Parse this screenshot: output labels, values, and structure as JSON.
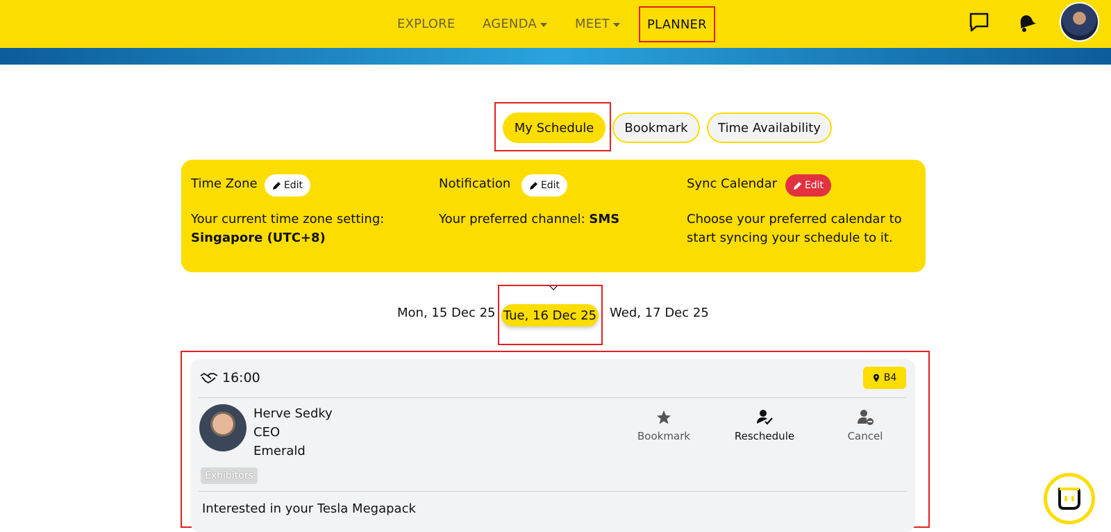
{
  "header": {
    "nav": [
      {
        "label": "EXPLORE"
      },
      {
        "label": "AGENDA"
      },
      {
        "label": "MEET"
      },
      {
        "label": "PLANNER"
      }
    ],
    "icons": [
      "chat-icon",
      "bell-icon",
      "avatar"
    ]
  },
  "tabs": [
    {
      "label": "My Schedule"
    },
    {
      "label": "Bookmark"
    },
    {
      "label": "Time Availability"
    }
  ],
  "settings": {
    "timezone": {
      "title": "Time Zone",
      "edit": "Edit",
      "text": "Your current time zone setting:",
      "value": "Singapore (UTC+8)"
    },
    "notification": {
      "title": "Notification",
      "edit": "Edit",
      "text": "Your preferred channel:",
      "value": "SMS"
    },
    "sync": {
      "title": "Sync Calendar",
      "edit": "Edit",
      "line1": "Choose your preferred calendar to",
      "line2": "start syncing your schedule to it."
    }
  },
  "dates": [
    {
      "label": "Mon, 15 Dec 25"
    },
    {
      "label": "Tue, 16 Dec 25"
    },
    {
      "label": "Wed, 17 Dec 25"
    }
  ],
  "meeting": {
    "time": "16:00",
    "location": "B4",
    "name": "Herve Sedky",
    "role": "CEO",
    "company": "Emerald",
    "tag": "Exhibitors",
    "actions": {
      "bookmark": "Bookmark",
      "reschedule": "Reschedule",
      "cancel": "Cancel"
    },
    "note": "Interested in your Tesla Megapack"
  },
  "colors": {
    "accent": "#fcdd00",
    "highlight": "#e41f1f",
    "danger": "#e3323f"
  }
}
